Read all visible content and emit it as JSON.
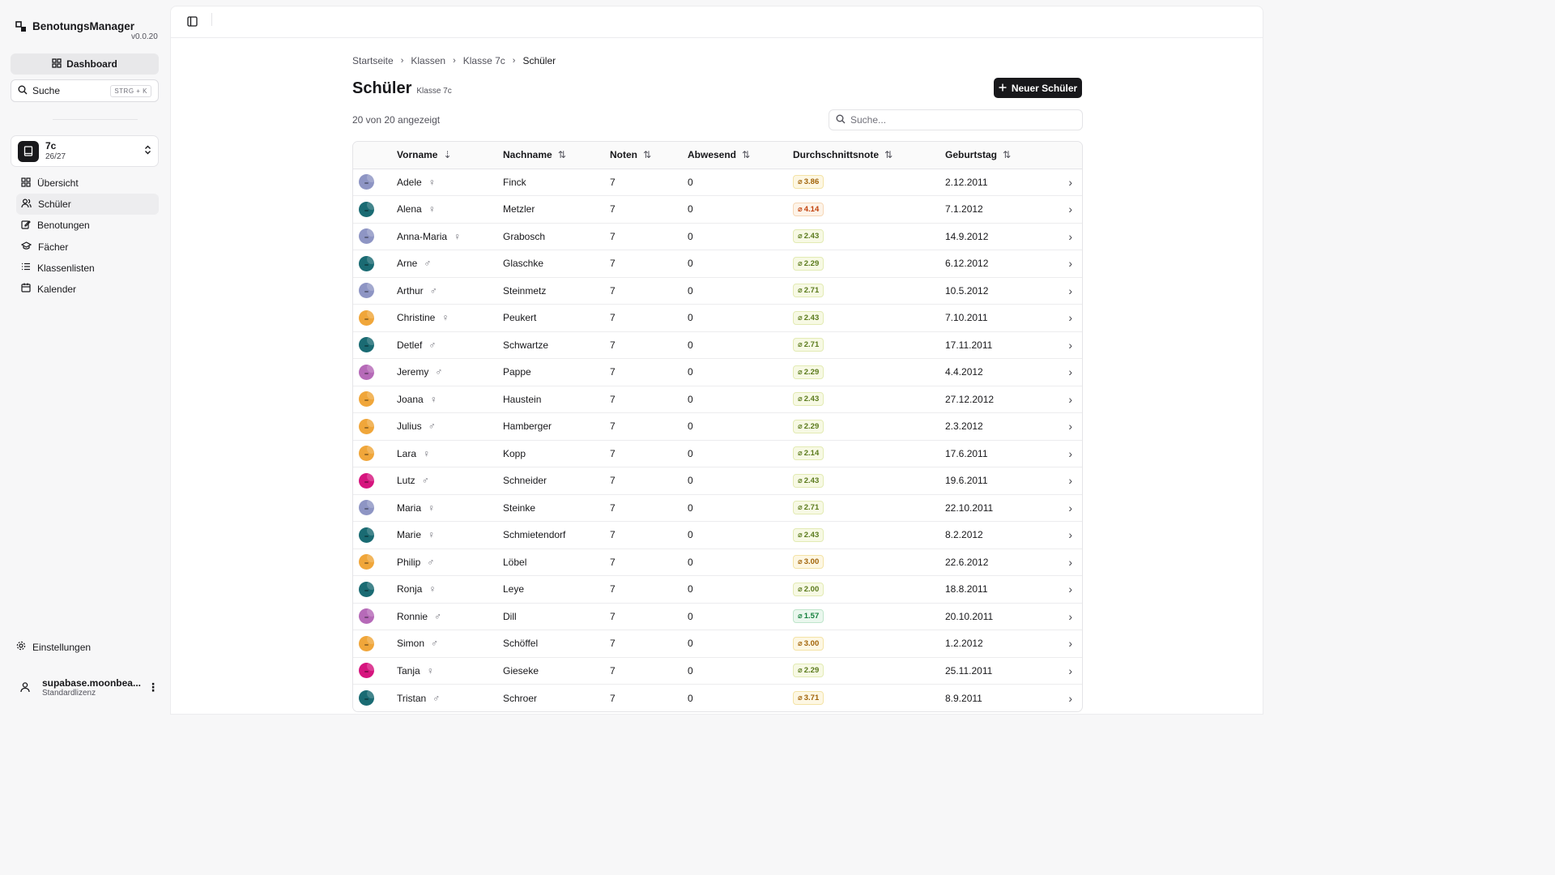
{
  "app": {
    "name": "BenotungsManager",
    "version": "v0.0.20"
  },
  "sidebar": {
    "dashboard_label": "Dashboard",
    "search_label": "Suche",
    "search_shortcut": "STRG + K",
    "class_switch": {
      "title": "7c",
      "subtitle": "26/27"
    },
    "nav": [
      {
        "label": "Übersicht",
        "icon": "grid-icon"
      },
      {
        "label": "Schüler",
        "icon": "users-icon"
      },
      {
        "label": "Benotungen",
        "icon": "edit-icon"
      },
      {
        "label": "Fächer",
        "icon": "graduation-cap-icon"
      },
      {
        "label": "Klassenlisten",
        "icon": "list-icon"
      },
      {
        "label": "Kalender",
        "icon": "calendar-icon"
      }
    ],
    "settings_label": "Einstellungen",
    "user": {
      "name": "supabase.moonbea...",
      "license": "Standardlizenz"
    }
  },
  "breadcrumb": [
    "Startseite",
    "Klassen",
    "Klasse 7c",
    "Schüler"
  ],
  "page": {
    "title": "Schüler",
    "subtitle": "Klasse 7c",
    "new_button": "Neuer Schüler",
    "count": "20 von 20 angezeigt",
    "search_placeholder": "Suche..."
  },
  "table": {
    "headers": [
      "Vorname",
      "Nachname",
      "Noten",
      "Abwesend",
      "Durchschnittsnote",
      "Geburtstag"
    ],
    "rows": [
      {
        "first": "Adele",
        "gender": "♀",
        "last": "Finck",
        "grades": "7",
        "absent": "0",
        "avg": "3.86",
        "level": "warn",
        "birthday": "2.12.2011",
        "avatar": "#8e95c4"
      },
      {
        "first": "Alena",
        "gender": "♀",
        "last": "Metzler",
        "grades": "7",
        "absent": "0",
        "avg": "4.14",
        "level": "bad",
        "birthday": "7.1.2012",
        "avatar": "#1a6b73"
      },
      {
        "first": "Anna-Maria",
        "gender": "♀",
        "last": "Grabosch",
        "grades": "7",
        "absent": "0",
        "avg": "2.43",
        "level": "good",
        "birthday": "14.9.2012",
        "avatar": "#8e95c4"
      },
      {
        "first": "Arne",
        "gender": "♂",
        "last": "Glaschke",
        "grades": "7",
        "absent": "0",
        "avg": "2.29",
        "level": "good",
        "birthday": "6.12.2012",
        "avatar": "#1a6b73"
      },
      {
        "first": "Arthur",
        "gender": "♂",
        "last": "Steinmetz",
        "grades": "7",
        "absent": "0",
        "avg": "2.71",
        "level": "good",
        "birthday": "10.5.2012",
        "avatar": "#8e95c4"
      },
      {
        "first": "Christine",
        "gender": "♀",
        "last": "Peukert",
        "grades": "7",
        "absent": "0",
        "avg": "2.43",
        "level": "good",
        "birthday": "7.10.2011",
        "avatar": "#f0a63a"
      },
      {
        "first": "Detlef",
        "gender": "♂",
        "last": "Schwartze",
        "grades": "7",
        "absent": "0",
        "avg": "2.71",
        "level": "good",
        "birthday": "17.11.2011",
        "avatar": "#1a6b73"
      },
      {
        "first": "Jeremy",
        "gender": "♂",
        "last": "Pappe",
        "grades": "7",
        "absent": "0",
        "avg": "2.29",
        "level": "good",
        "birthday": "4.4.2012",
        "avatar": "#b66ab8"
      },
      {
        "first": "Joana",
        "gender": "♀",
        "last": "Haustein",
        "grades": "7",
        "absent": "0",
        "avg": "2.43",
        "level": "good",
        "birthday": "27.12.2012",
        "avatar": "#f0a63a"
      },
      {
        "first": "Julius",
        "gender": "♂",
        "last": "Hamberger",
        "grades": "7",
        "absent": "0",
        "avg": "2.29",
        "level": "good",
        "birthday": "2.3.2012",
        "avatar": "#f0a63a"
      },
      {
        "first": "Lara",
        "gender": "♀",
        "last": "Kopp",
        "grades": "7",
        "absent": "0",
        "avg": "2.14",
        "level": "good",
        "birthday": "17.6.2011",
        "avatar": "#f0a63a"
      },
      {
        "first": "Lutz",
        "gender": "♂",
        "last": "Schneider",
        "grades": "7",
        "absent": "0",
        "avg": "2.43",
        "level": "good",
        "birthday": "19.6.2011",
        "avatar": "#d6157e"
      },
      {
        "first": "Maria",
        "gender": "♀",
        "last": "Steinke",
        "grades": "7",
        "absent": "0",
        "avg": "2.71",
        "level": "good",
        "birthday": "22.10.2011",
        "avatar": "#8e95c4"
      },
      {
        "first": "Marie",
        "gender": "♀",
        "last": "Schmietendorf",
        "grades": "7",
        "absent": "0",
        "avg": "2.43",
        "level": "good",
        "birthday": "8.2.2012",
        "avatar": "#1a6b73"
      },
      {
        "first": "Philip",
        "gender": "♂",
        "last": "Löbel",
        "grades": "7",
        "absent": "0",
        "avg": "3.00",
        "level": "warn",
        "birthday": "22.6.2012",
        "avatar": "#f0a63a"
      },
      {
        "first": "Ronja",
        "gender": "♀",
        "last": "Leye",
        "grades": "7",
        "absent": "0",
        "avg": "2.00",
        "level": "good",
        "birthday": "18.8.2011",
        "avatar": "#1a6b73"
      },
      {
        "first": "Ronnie",
        "gender": "♂",
        "last": "Dill",
        "grades": "7",
        "absent": "0",
        "avg": "1.57",
        "level": "best",
        "birthday": "20.10.2011",
        "avatar": "#b66ab8"
      },
      {
        "first": "Simon",
        "gender": "♂",
        "last": "Schöffel",
        "grades": "7",
        "absent": "0",
        "avg": "3.00",
        "level": "warn",
        "birthday": "1.2.2012",
        "avatar": "#f0a63a"
      },
      {
        "first": "Tanja",
        "gender": "♀",
        "last": "Gieseke",
        "grades": "7",
        "absent": "0",
        "avg": "2.29",
        "level": "good",
        "birthday": "25.11.2011",
        "avatar": "#d6157e"
      },
      {
        "first": "Tristan",
        "gender": "♂",
        "last": "Schroer",
        "grades": "7",
        "absent": "0",
        "avg": "3.71",
        "level": "warn",
        "birthday": "8.9.2011",
        "avatar": "#1a6b73"
      }
    ]
  }
}
